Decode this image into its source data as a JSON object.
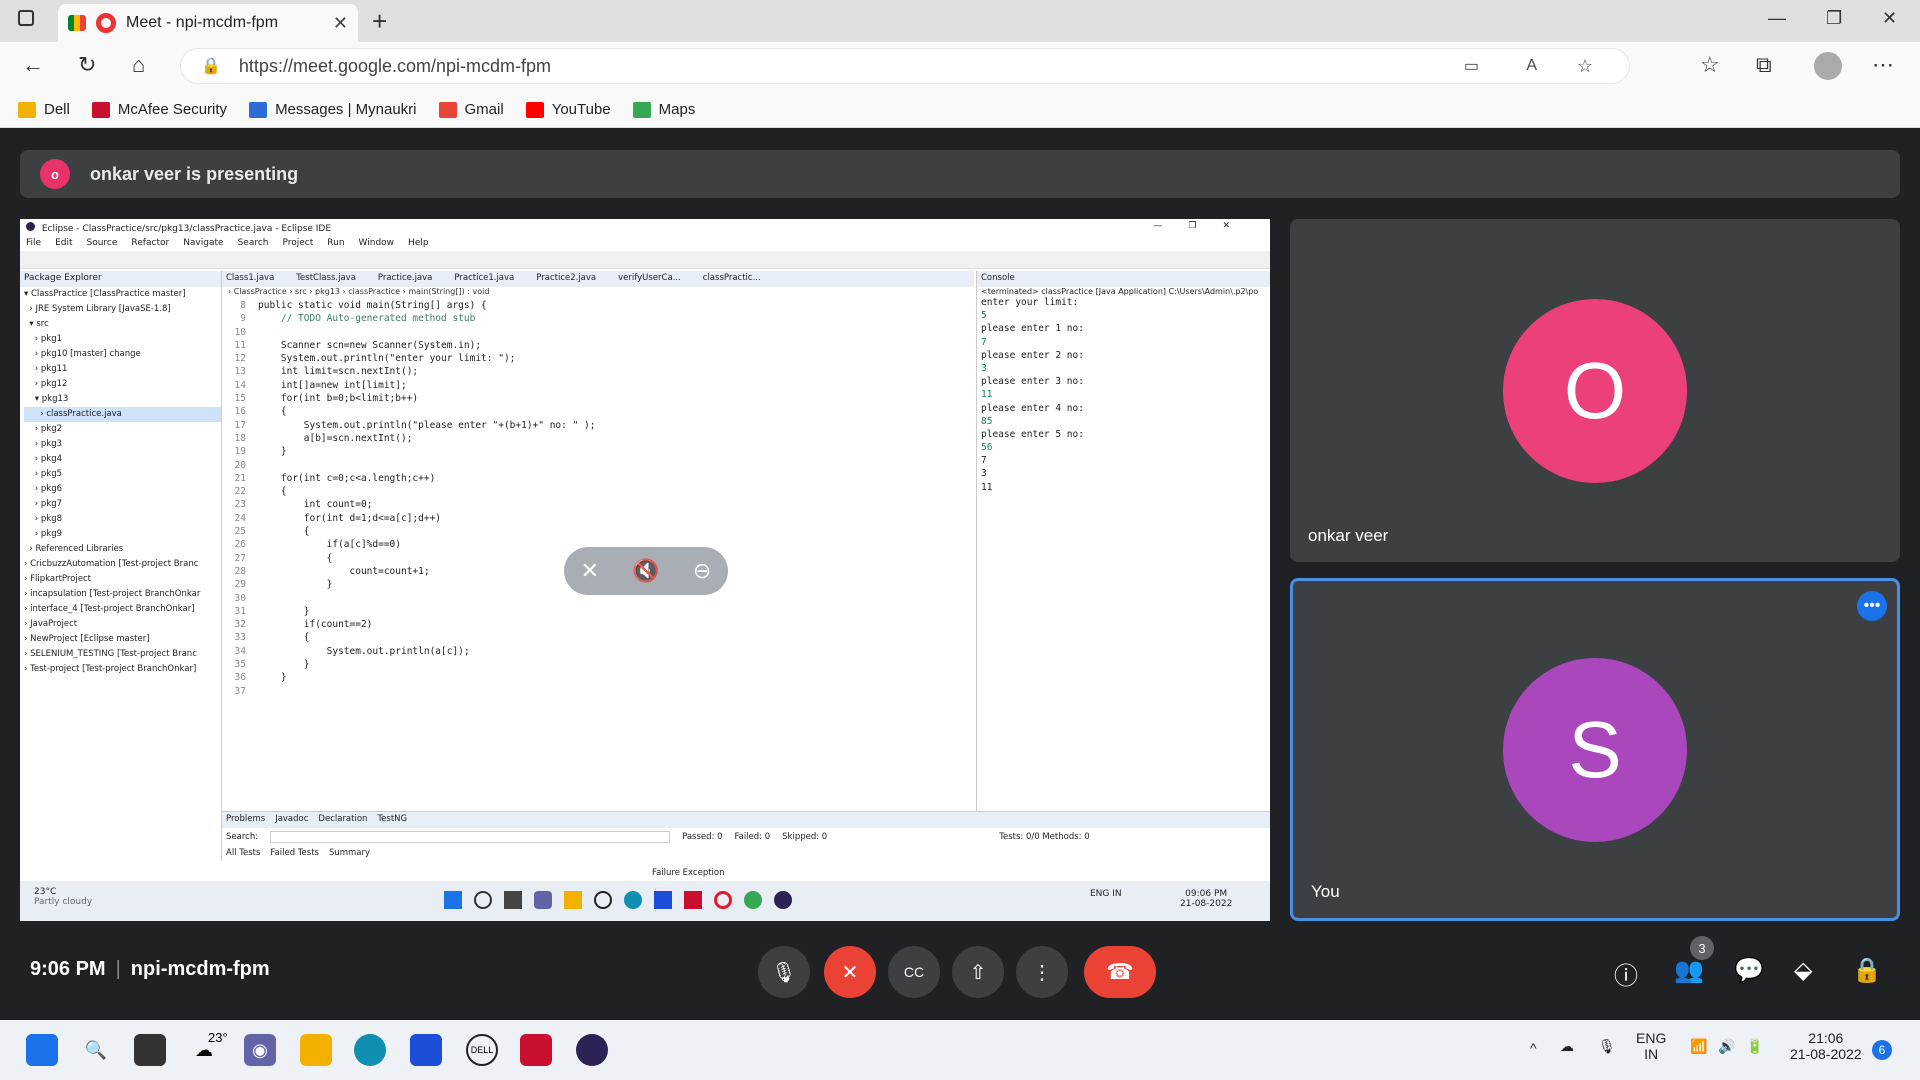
{
  "browser": {
    "tab_title": "Meet - npi-mcdm-fpm",
    "tab_close": "✕",
    "new_tab": "+",
    "url": "https://meet.google.com/npi-mcdm-fpm",
    "bookmarks": [
      {
        "label": "Dell",
        "color": "#f2b100"
      },
      {
        "label": "McAfee Security",
        "color": "#c8102e"
      },
      {
        "label": "Messages | Mynaukri",
        "color": "#2d6bd9"
      },
      {
        "label": "Gmail",
        "color": "#ea4335"
      },
      {
        "label": "YouTube",
        "color": "#ff0000"
      },
      {
        "label": "Maps",
        "color": "#34a853"
      }
    ]
  },
  "banner": {
    "avatar_letter": "o",
    "text": "onkar veer is presenting"
  },
  "eclipse": {
    "window_title": "Eclipse - ClassPractice/src/pkg13/classPractice.java - Eclipse IDE",
    "menu": [
      "File",
      "Edit",
      "Source",
      "Refactor",
      "Navigate",
      "Search",
      "Project",
      "Run",
      "Window",
      "Help"
    ],
    "package_explorer_title": "Package Explorer",
    "tree": [
      "▾ ClassPractice [ClassPractice master]",
      "  › JRE System Library [JavaSE-1.8]",
      "  ▾ src",
      "    › pkg1",
      "    › pkg10 [master] change",
      "    › pkg11",
      "    › pkg12",
      "    ▾ pkg13",
      "      › classPractice.java",
      "    › pkg2",
      "    › pkg3",
      "    › pkg4",
      "    › pkg5",
      "    › pkg6",
      "    › pkg7",
      "    › pkg8",
      "    › pkg9",
      "  › Referenced Libraries",
      "› CricbuzzAutomation [Test-project Branc",
      "› FlipkartProject",
      "› incapsulation [Test-project BranchOnkar",
      "› interface_4 [Test-project BranchOnkar]",
      "› JavaProject",
      "› NewProject [Eclipse master]",
      "› SELENIUM_TESTING [Test-project Branc",
      "› Test-project [Test-project BranchOnkar]"
    ],
    "editor_tabs": [
      "Class1.java",
      "TestClass.java",
      "Practice.java",
      "Practice1.java",
      "Practice2.java",
      "verifyUserCa...",
      "classPractic..."
    ],
    "breadcrumb": "› ClassPractice › src › pkg13 › classPractice › main(String[]) : void",
    "line_numbers": [
      "8",
      "9",
      "10",
      "11",
      "12",
      "13",
      "14",
      "15",
      "16",
      "17",
      "18",
      "19",
      "20",
      "21",
      "22",
      "23",
      "24",
      "25",
      "26",
      "27",
      "28",
      "29",
      "30",
      "31",
      "32",
      "33",
      "34",
      "35",
      "36",
      "37"
    ],
    "code_lines": [
      "public static void main(String[] args) {",
      "    // TODO Auto-generated method stub",
      "",
      "    Scanner scn=new Scanner(System.in);",
      "    System.out.println(\"enter your limit: \");",
      "    int limit=scn.nextInt();",
      "    int[]a=new int[limit];",
      "    for(int b=0;b<limit;b++)",
      "    {",
      "        System.out.println(\"please enter \"+(b+1)+\" no: \" );",
      "        a[b]=scn.nextInt();",
      "    }",
      "",
      "    for(int c=0;c<a.length;c++)",
      "    {",
      "        int count=0;",
      "        for(int d=1;d<=a[c];d++)",
      "        {",
      "            if(a[c]%d==0)",
      "            {",
      "                count=count+1;",
      "            }",
      "",
      "        }",
      "        if(count==2)",
      "        {",
      "            System.out.println(a[c]);",
      "        }",
      "    }",
      ""
    ],
    "console_title": "Console",
    "console_header": "<terminated> classPractice [Java Application] C:\\Users\\Admin\\.p2\\po",
    "console_lines": [
      {
        "t": "enter your limit:",
        "in": false
      },
      {
        "t": "5",
        "in": true
      },
      {
        "t": "please enter 1 no:",
        "in": false
      },
      {
        "t": "7",
        "in": true
      },
      {
        "t": "please enter 2 no:",
        "in": false
      },
      {
        "t": "3",
        "in": true
      },
      {
        "t": "please enter 3 no:",
        "in": false
      },
      {
        "t": "11",
        "in": true
      },
      {
        "t": "please enter 4 no:",
        "in": false
      },
      {
        "t": "85",
        "in": true
      },
      {
        "t": "please enter 5 no:",
        "in": false
      },
      {
        "t": "56",
        "in": true
      },
      {
        "t": "7",
        "in": false
      },
      {
        "t": "3",
        "in": false
      },
      {
        "t": "11",
        "in": false
      }
    ],
    "bottom_tabs": [
      "Problems",
      "Javadoc",
      "Declaration",
      "TestNG"
    ],
    "search_label": "Search:",
    "passed": "Passed: 0",
    "failed": "Failed: 0",
    "skipped": "Skipped: 0",
    "tests": "Tests: 0/0  Methods: 0",
    "result_tabs": [
      "All Tests",
      "Failed Tests",
      "Summary"
    ],
    "failure_exception": "Failure Exception",
    "weather_temp": "23°C",
    "weather_desc": "Partly cloudy",
    "tray_lang": "ENG\nIN",
    "tray_time": "09:06 PM",
    "tray_date": "21-08-2022"
  },
  "participants": [
    {
      "name": "onkar veer",
      "letter": "O",
      "color": "#ec407a"
    },
    {
      "name": "You",
      "letter": "S",
      "color": "#ab47bc"
    }
  ],
  "meeting": {
    "time": "9:06 PM",
    "code": "npi-mcdm-fpm",
    "participant_count": "3"
  },
  "taskbar": {
    "temp": "23°",
    "lang1": "ENG",
    "lang2": "IN",
    "time": "21:06",
    "date": "21-08-2022",
    "notifications": "6"
  }
}
